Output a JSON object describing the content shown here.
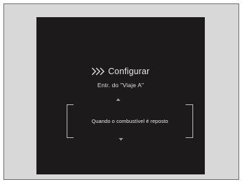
{
  "screen": {
    "chevron_icon": "triple-chevron-right-icon",
    "title": "Configurar",
    "subtitle": "Entr. do \"Viaje A\"",
    "selected_option": "Quando o combustível é reposto",
    "up_icon": "caret-up-icon",
    "down_icon": "caret-down-icon",
    "colors": {
      "background": "#1c1a1b",
      "text": "#e8e8e8",
      "frame": "#d8d8d8"
    }
  }
}
